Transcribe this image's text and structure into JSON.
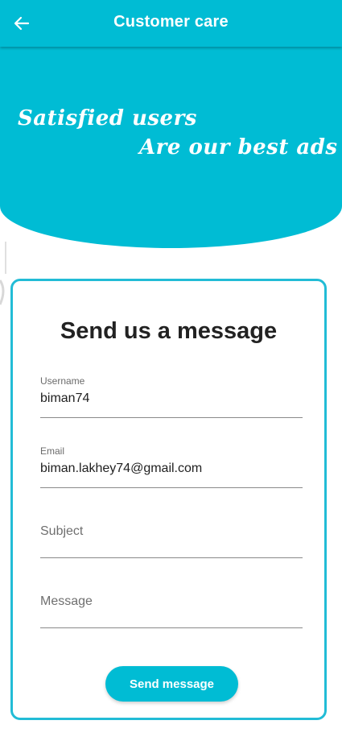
{
  "app_bar": {
    "title": "Customer care",
    "back_icon": "arrow-left-icon",
    "color": "#00bcd4"
  },
  "banner": {
    "line1": "Satisfied users",
    "line2": "Are our best ads"
  },
  "form": {
    "title": "Send us a message",
    "username": {
      "label": "Username",
      "value": "biman74"
    },
    "email": {
      "label": "Email",
      "value": "biman.lakhey74@gmail.com"
    },
    "subject": {
      "placeholder": "Subject"
    },
    "message": {
      "placeholder": "Message"
    },
    "send_label": "Send message",
    "accent_color": "#22bcd6"
  }
}
